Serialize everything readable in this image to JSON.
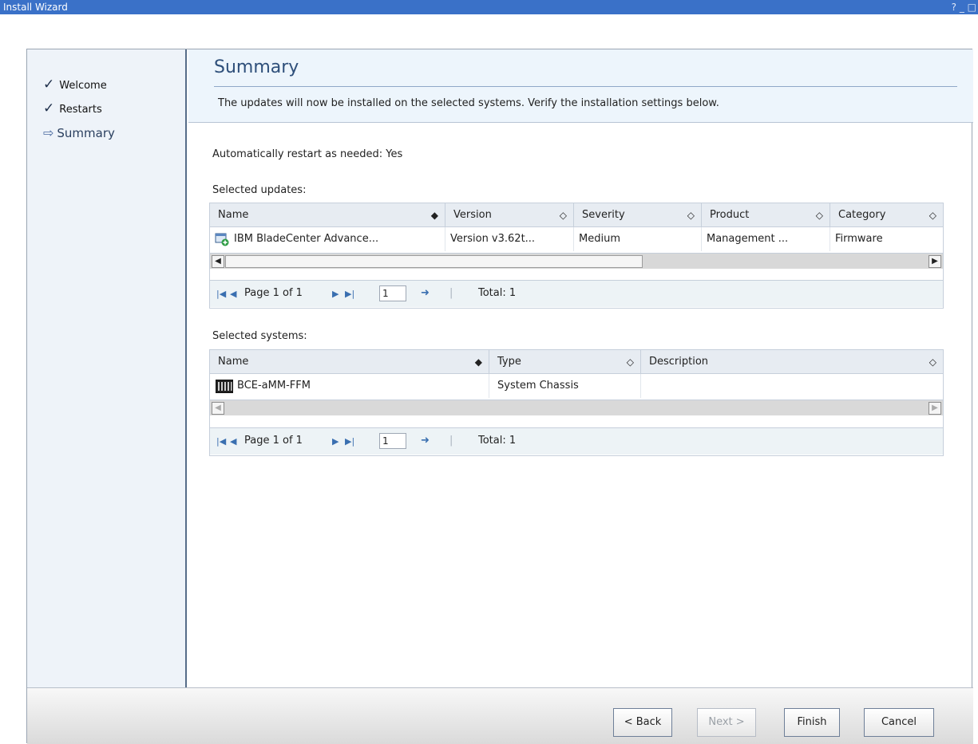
{
  "window": {
    "title": "Install Wizard",
    "controls": "? _ □"
  },
  "steps": [
    {
      "label": "Welcome",
      "state": "done",
      "icon": "checkmark-icon"
    },
    {
      "label": "Restarts",
      "state": "done",
      "icon": "checkmark-icon"
    },
    {
      "label": "Summary",
      "state": "current",
      "icon": "arrow-right-icon"
    }
  ],
  "header": {
    "title": "Summary",
    "description": "The updates will now be installed on the selected systems. Verify the installation settings below."
  },
  "main": {
    "restart_setting": "Automatically restart as needed: Yes",
    "updates_label": "Selected updates:",
    "systems_label": "Selected systems:"
  },
  "updates_table": {
    "columns": [
      "Name",
      "Version",
      "Severity",
      "Product",
      "Category"
    ],
    "rows": [
      {
        "name": "IBM BladeCenter Advance...",
        "version": "Version v3.62t...",
        "severity": "Medium",
        "product": "Management ...",
        "category": "Firmware"
      }
    ],
    "pager": {
      "page_text": "Page 1 of 1",
      "page_input": "1",
      "total": "Total: 1"
    }
  },
  "systems_table": {
    "columns": [
      "Name",
      "Type",
      "Description"
    ],
    "rows": [
      {
        "name": "BCE-aMM-FFM",
        "type": "System Chassis",
        "description": ""
      }
    ],
    "pager": {
      "page_text": "Page 1 of 1",
      "page_input": "1",
      "total": "Total: 1"
    }
  },
  "buttons": {
    "back": "< Back",
    "next": "Next >",
    "finish": "Finish",
    "cancel": "Cancel"
  }
}
